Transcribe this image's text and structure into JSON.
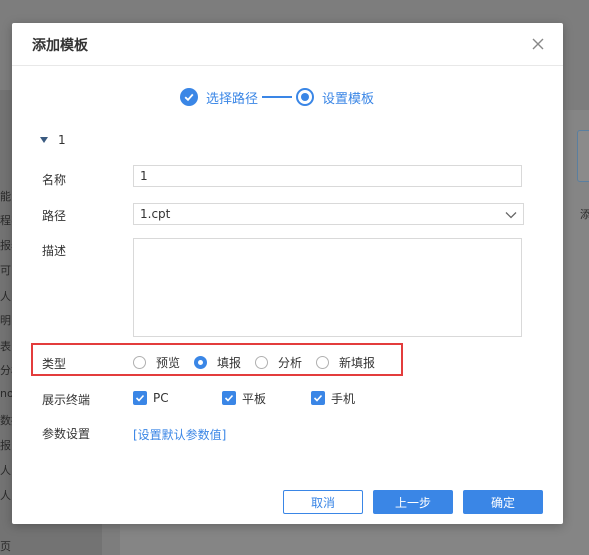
{
  "background": {
    "sidebar_lines": [
      "能",
      "程实",
      "报表",
      "可",
      "人",
      "明",
      "表",
      "分析",
      "no",
      "数据",
      "报",
      "人",
      "人",
      "页"
    ],
    "right_text": "添"
  },
  "dialog": {
    "title": "添加模板",
    "close_icon": "close-icon"
  },
  "steps": [
    {
      "label": "选择路径",
      "state": "done"
    },
    {
      "label": "设置模板",
      "state": "current"
    }
  ],
  "section": {
    "label": "1",
    "expanded": true
  },
  "form": {
    "name_label": "名称",
    "name_value": "1",
    "path_label": "路径",
    "path_value": "1.cpt",
    "desc_label": "描述",
    "desc_value": "",
    "type_label": "类型",
    "type_options": [
      {
        "label": "预览",
        "checked": false
      },
      {
        "label": "填报",
        "checked": true
      },
      {
        "label": "分析",
        "checked": false
      },
      {
        "label": "新填报",
        "checked": false
      }
    ],
    "terminal_label": "展示终端",
    "terminal_options": [
      {
        "label": "PC",
        "checked": true
      },
      {
        "label": "平板",
        "checked": true
      },
      {
        "label": "手机",
        "checked": true
      }
    ],
    "param_label": "参数设置",
    "param_link": "[设置默认参数值]"
  },
  "buttons": {
    "cancel": "取消",
    "prev": "上一步",
    "ok": "确定"
  },
  "colors": {
    "accent": "#3a86e6",
    "highlight": "#e33c3c"
  }
}
